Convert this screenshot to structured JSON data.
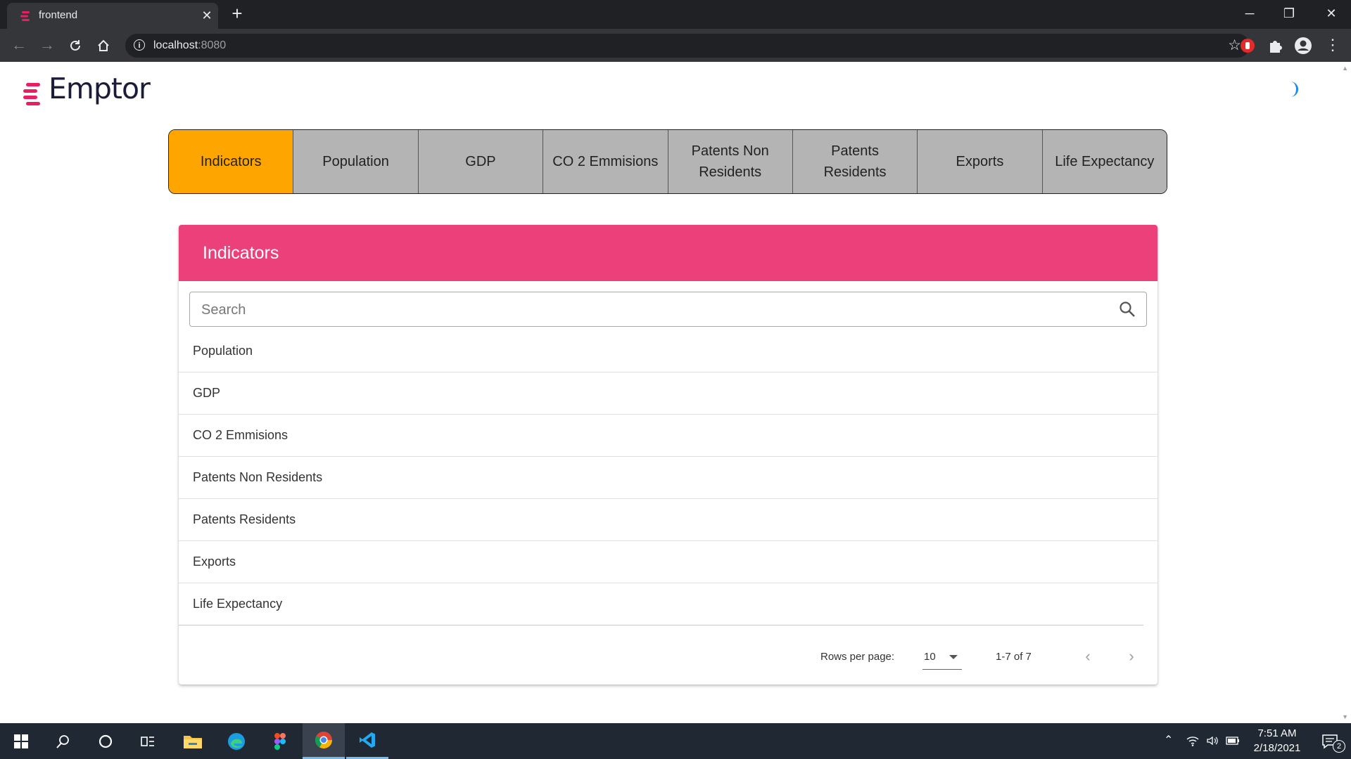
{
  "browser": {
    "tab_title": "frontend",
    "url_host": "localhost",
    "url_port": ":8080"
  },
  "app": {
    "logo_text": "Emptor",
    "brand_color": "#e91e63"
  },
  "nav_tabs": [
    {
      "label": "Indicators",
      "active": true
    },
    {
      "label": "Population",
      "active": false
    },
    {
      "label": "GDP",
      "active": false
    },
    {
      "label": "CO 2 Emmisions",
      "active": false
    },
    {
      "label": "Patents Non Residents",
      "active": false
    },
    {
      "label": "Patents Residents",
      "active": false
    },
    {
      "label": "Exports",
      "active": false
    },
    {
      "label": "Life Expectancy",
      "active": false
    }
  ],
  "card": {
    "title": "Indicators",
    "header_color": "#ec407a",
    "search_placeholder": "Search",
    "rows": [
      "Population",
      "GDP",
      "CO 2 Emmisions",
      "Patents Non Residents",
      "Patents Residents",
      "Exports",
      "Life Expectancy"
    ]
  },
  "pagination": {
    "rows_per_page_label": "Rows per page:",
    "rows_per_page_value": "10",
    "range_text": "1-7 of 7"
  },
  "taskbar": {
    "time": "7:51 AM",
    "date": "2/18/2021",
    "notification_count": "2"
  }
}
